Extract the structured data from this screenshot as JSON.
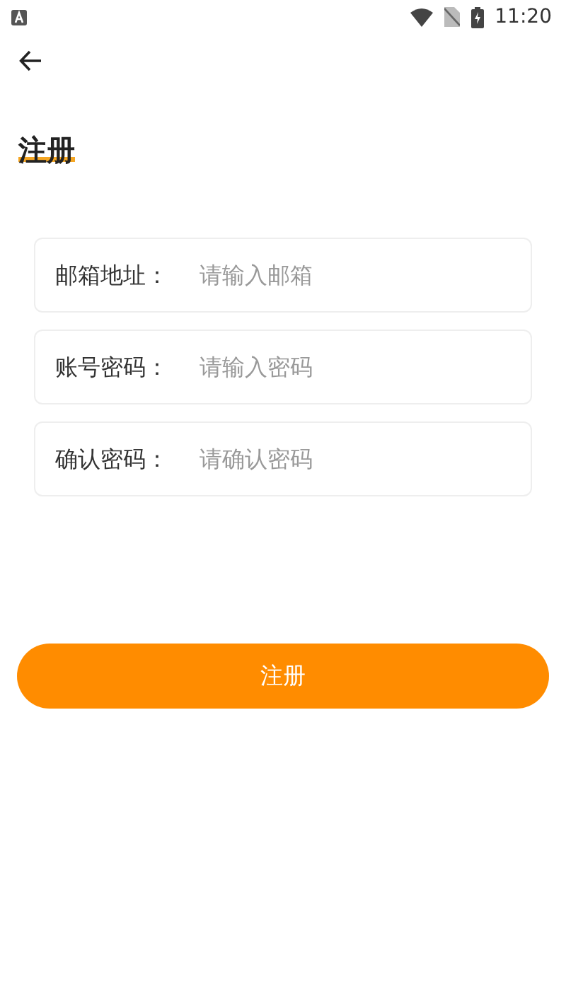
{
  "status_bar": {
    "time": "11:20"
  },
  "title": "注册",
  "fields": [
    {
      "label": "邮箱地址：",
      "placeholder": "请输入邮箱"
    },
    {
      "label": "账号密码：",
      "placeholder": "请输入密码"
    },
    {
      "label": "确认密码：",
      "placeholder": "请确认密码"
    }
  ],
  "submit_button": "注册"
}
